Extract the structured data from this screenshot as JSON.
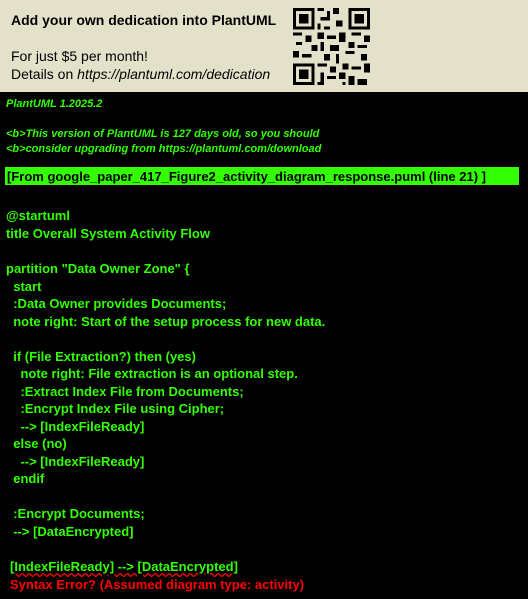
{
  "banner": {
    "headline": "Add your own dedication into PlantUML",
    "price_line": "For just $5 per month!",
    "details_prefix": "Details on ",
    "details_url": "https://plantuml.com/dedication"
  },
  "version_line": "PlantUML 1.2025.2",
  "warning_lines": [
    "<b>This version of PlantUML is 127 days old, so you should",
    "<b>consider upgrading from https://plantuml.com/download"
  ],
  "source_ref": "[From google_paper_417_Figure2_activity_diagram_response.puml (line 21) ]",
  "code_lines": [
    "@startuml",
    "title Overall System Activity Flow",
    "",
    "partition \"Data Owner Zone\" {",
    "  start",
    "  :Data Owner provides Documents;",
    "  note right: Start of the setup process for new data.",
    "",
    "  if (File Extraction?) then (yes)",
    "    note right: File extraction is an optional step.",
    "    :Extract Index File from Documents;",
    "    :Encrypt Index File using Cipher;",
    "    --> [IndexFileReady]",
    "  else (no)",
    "    --> [IndexFileReady]",
    "  endif",
    "",
    "  :Encrypt Documents;",
    "  --> [DataEncrypted]",
    ""
  ],
  "error_code_line": "[IndexFileReady] --> [DataEncrypted]",
  "error_message": "Syntax Error? (Assumed diagram type: activity)",
  "colors": {
    "background": "#000000",
    "banner": "#e4e1ca",
    "code_green": "#33ff02",
    "error_red": "#ff0000"
  }
}
